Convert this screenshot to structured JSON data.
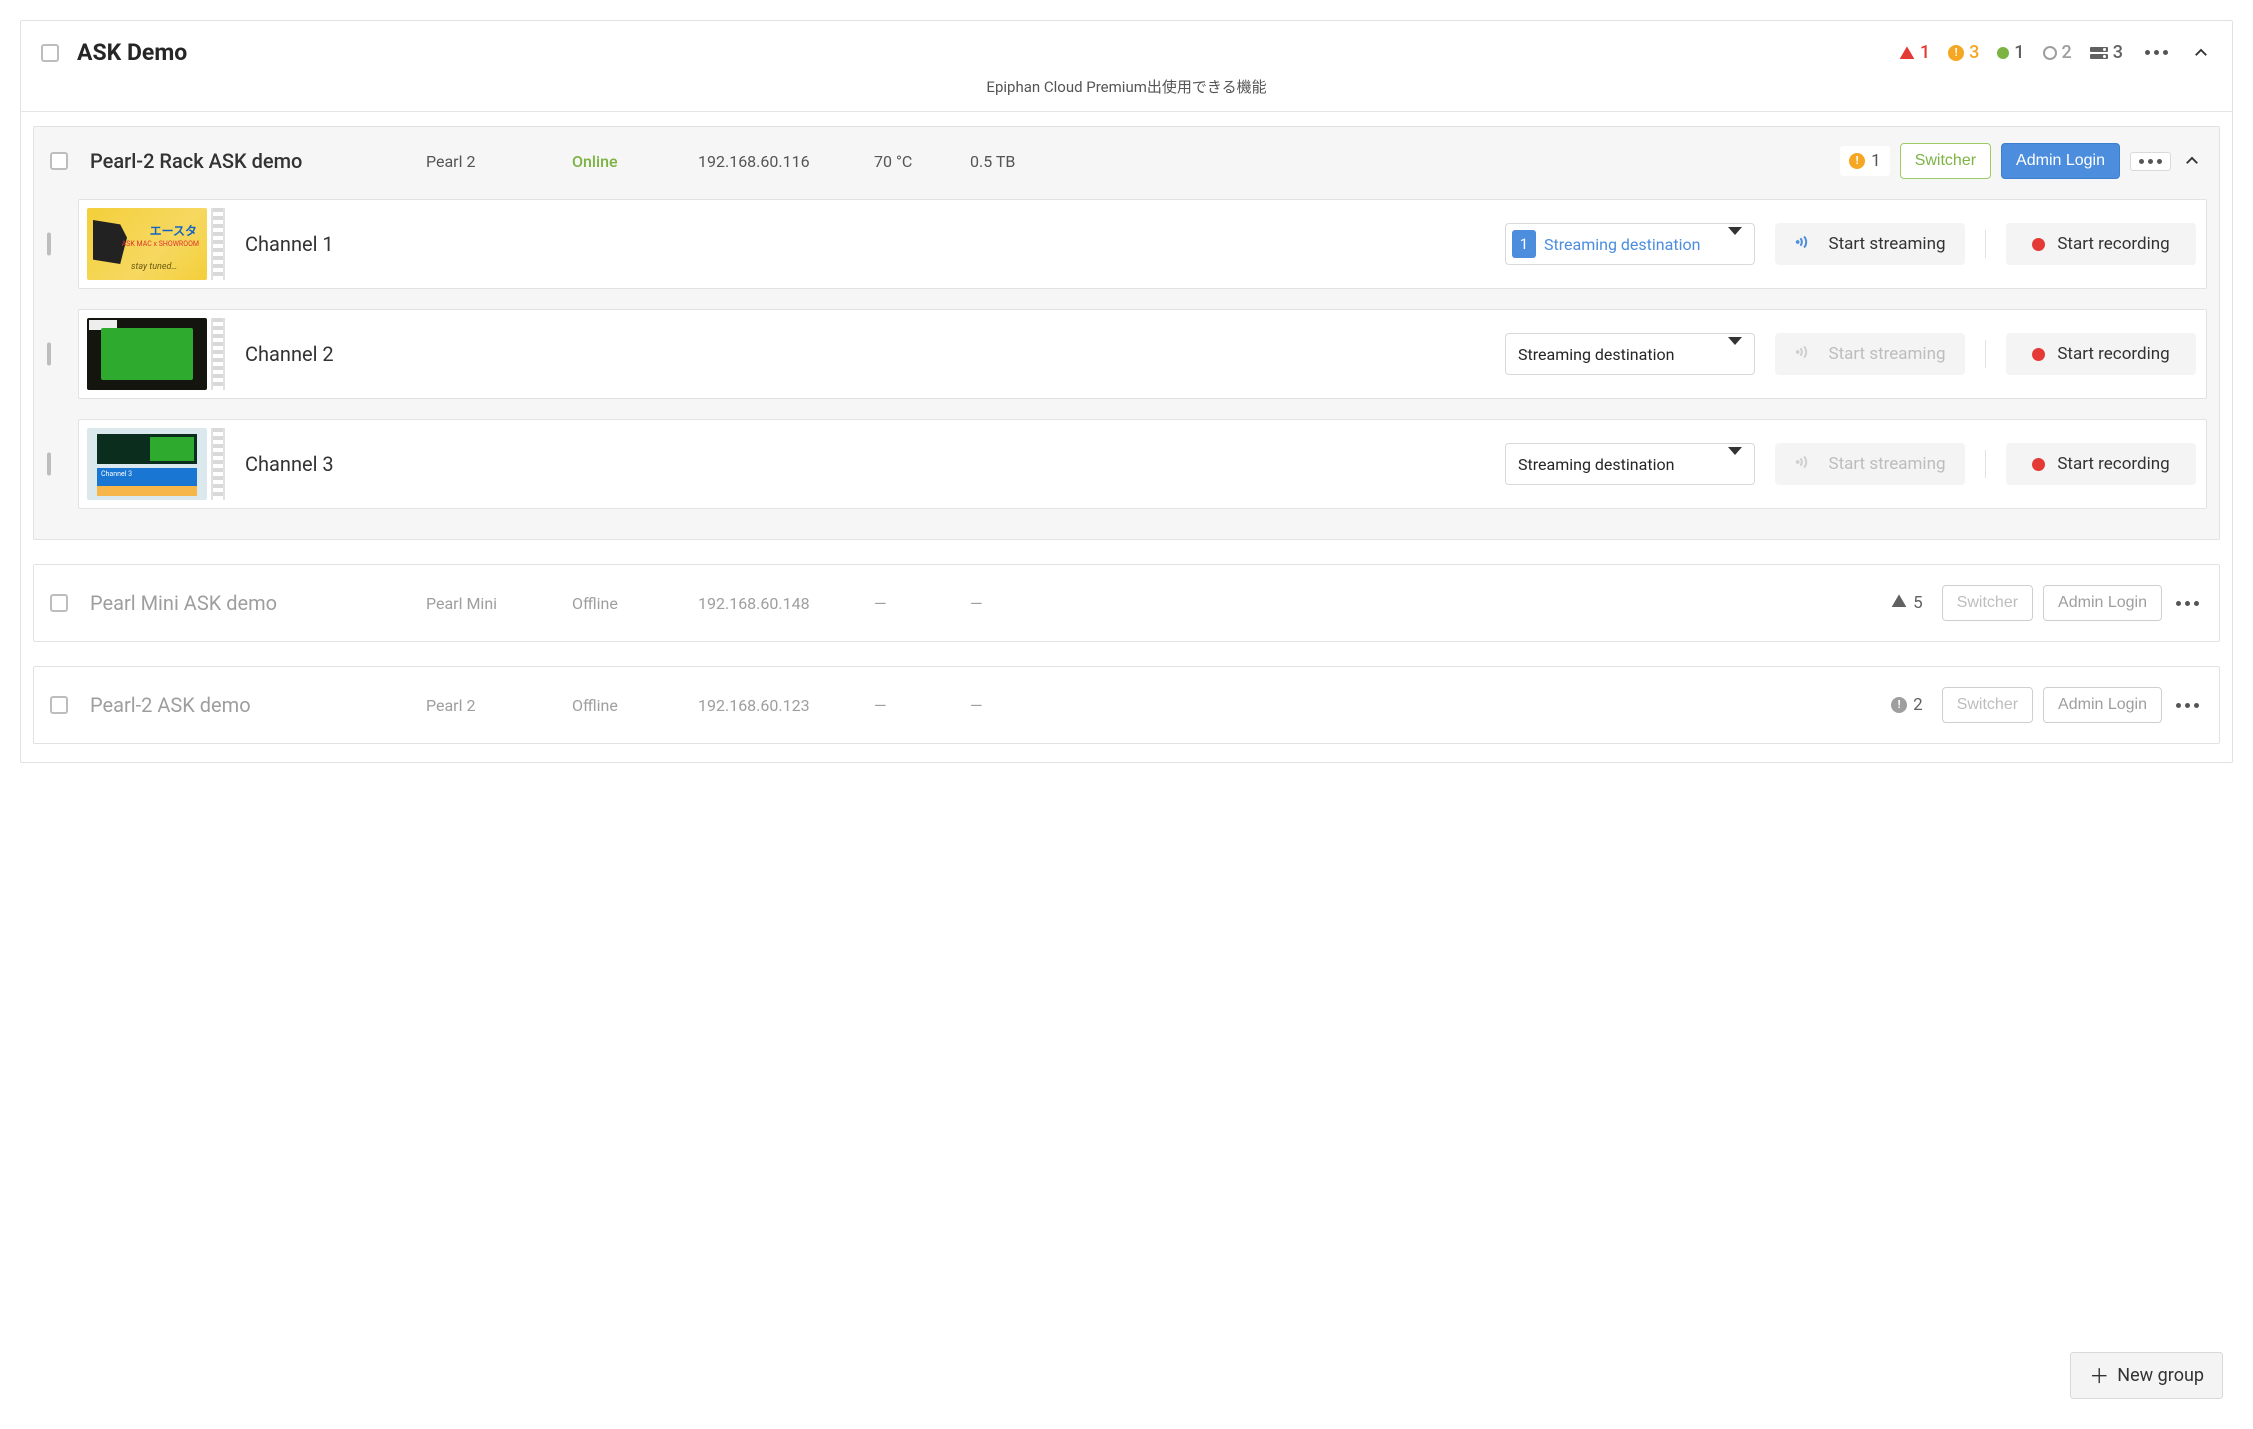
{
  "group": {
    "title": "ASK Demo",
    "subtitle": "Epiphan Cloud Premium出使用できる機能",
    "stats": {
      "errors": "1",
      "warnings": "3",
      "online": "1",
      "offline": "2",
      "storage": "3"
    }
  },
  "labels": {
    "switcher": "Switcher",
    "admin_login": "Admin Login",
    "start_streaming": "Start streaming",
    "start_recording": "Start recording",
    "streaming_destination": "Streaming destination",
    "new_group": "New group",
    "dash": "—"
  },
  "devices": [
    {
      "name": "Pearl-2 Rack ASK demo",
      "model": "Pearl 2",
      "status": "Online",
      "status_class": "online",
      "ip": "192.168.60.116",
      "temp": "70 °C",
      "storage": "0.5 TB",
      "alerts": {
        "type": "warn",
        "count": "1"
      },
      "enabled": true,
      "expanded": true,
      "channels": [
        {
          "name": "Channel 1",
          "dest_active": true,
          "dest_count": "1",
          "stream_enabled": true
        },
        {
          "name": "Channel 2",
          "dest_active": false,
          "stream_enabled": false
        },
        {
          "name": "Channel 3",
          "dest_active": false,
          "stream_enabled": false
        }
      ]
    },
    {
      "name": "Pearl Mini ASK demo",
      "model": "Pearl Mini",
      "status": "Offline",
      "status_class": "offline",
      "ip": "192.168.60.148",
      "temp": "—",
      "storage": "—",
      "alerts": {
        "type": "error",
        "count": "5"
      },
      "enabled": false,
      "expanded": false
    },
    {
      "name": "Pearl-2 ASK demo",
      "model": "Pearl 2",
      "status": "Offline",
      "status_class": "offline",
      "ip": "192.168.60.123",
      "temp": "—",
      "storage": "—",
      "alerts": {
        "type": "warn-gray",
        "count": "2"
      },
      "enabled": false,
      "expanded": false
    }
  ]
}
